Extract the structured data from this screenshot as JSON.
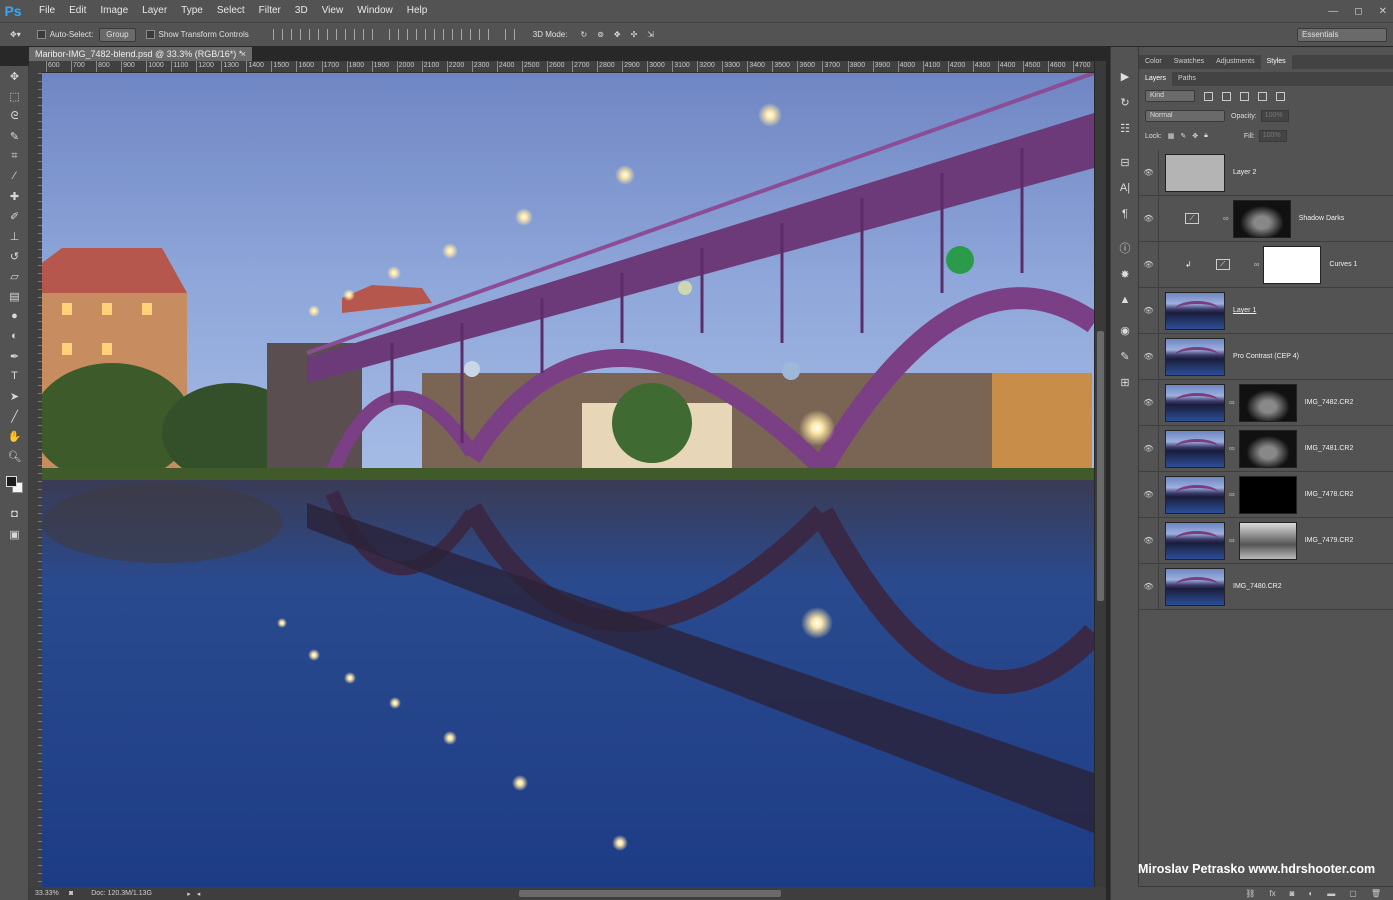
{
  "app": {
    "logo": "Ps",
    "menu": [
      "File",
      "Edit",
      "Image",
      "Layer",
      "Type",
      "Select",
      "Filter",
      "3D",
      "View",
      "Window",
      "Help"
    ],
    "window_controls": [
      "—",
      "◻",
      "✕"
    ]
  },
  "options": {
    "auto_select_label": "Auto-Select:",
    "auto_select_value": "Group",
    "transform_label": "Show Transform Controls",
    "mode_3d_label": "3D Mode:",
    "workspace": "Essentials"
  },
  "document": {
    "tab_title": "Maribor-IMG_7482-blend.psd @ 33.3% (RGB/16*) *",
    "ruler_ticks": [
      "600",
      "700",
      "800",
      "900",
      "1000",
      "1100",
      "1200",
      "1300",
      "1400",
      "1500",
      "1600",
      "1700",
      "1800",
      "1900",
      "2000",
      "2100",
      "2200",
      "2300",
      "2400",
      "2500",
      "2600",
      "2700",
      "2800",
      "2900",
      "3000",
      "3100",
      "3200",
      "3300",
      "3400",
      "3500",
      "3600",
      "3700",
      "3800",
      "3900",
      "4000",
      "4100",
      "4200",
      "4300",
      "4400",
      "4500",
      "4600",
      "4700"
    ],
    "zoom": "33.33%",
    "doc_size": "Doc: 120.3M/1.13G"
  },
  "tools": [
    "move-icon",
    "marquee-icon",
    "lasso-icon",
    "quick-select-icon",
    "crop-icon",
    "eyedropper-icon",
    "healing-icon",
    "brush-icon",
    "stamp-icon",
    "history-brush-icon",
    "eraser-icon",
    "gradient-icon",
    "blur-icon",
    "dodge-icon",
    "pen-icon",
    "type-icon",
    "path-select-icon",
    "shape-icon",
    "hand-icon",
    "zoom-icon"
  ],
  "panels": {
    "top_tabs": [
      "Color",
      "Swatches",
      "Adjustments",
      "Styles"
    ],
    "active_top_tab": "Styles",
    "layer_tabs": [
      "Layers",
      "Paths"
    ],
    "filter_kind": "Kind",
    "blend_mode": "Normal",
    "opacity_label": "Opacity:",
    "opacity_value": "100%",
    "lock_label": "Lock:",
    "fill_label": "Fill:",
    "fill_value": "100%"
  },
  "layers": [
    {
      "name": "Layer 2"
    },
    {
      "name": "Shadow Darks"
    },
    {
      "name": "Curves 1"
    },
    {
      "name": "Layer 1"
    },
    {
      "name": "Pro Contrast (CEP 4)"
    },
    {
      "name": "IMG_7482.CR2"
    },
    {
      "name": "IMG_7481.CR2"
    },
    {
      "name": "IMG_7478.CR2"
    },
    {
      "name": "IMG_7479.CR2"
    },
    {
      "name": "IMG_7480.CR2"
    }
  ],
  "watermark": "Miroslav  Petrasko  www.hdrshooter.com",
  "colors": {
    "ui_bg": "#535353",
    "canvas_sky": "#8fa6d8",
    "bridge": "#7b3f86",
    "water": "#1f3f86"
  }
}
